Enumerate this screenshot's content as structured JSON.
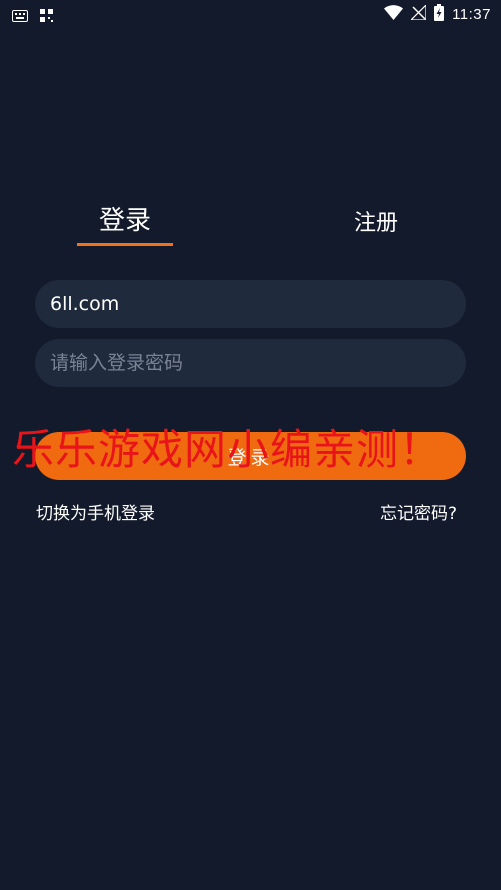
{
  "status_bar": {
    "time": "11:37",
    "icons": [
      "keyboard-icon",
      "qr-icon",
      "wifi-icon",
      "no-signal-icon",
      "battery-charging-icon"
    ]
  },
  "tabs": [
    {
      "label": "登录",
      "active": true
    },
    {
      "label": "注册",
      "active": false
    }
  ],
  "form": {
    "account_value": "6ll.com",
    "password_placeholder": "请输入登录密码",
    "login_button": "登录"
  },
  "links": {
    "switch_phone": "切换为手机登录",
    "forgot_password": "忘记密码?"
  },
  "watermark": "乐乐游戏网小编亲测！",
  "colors": {
    "background": "#131a2b",
    "field": "#1f2a3d",
    "accent": "#f06a10",
    "watermark": "#e8141a"
  }
}
